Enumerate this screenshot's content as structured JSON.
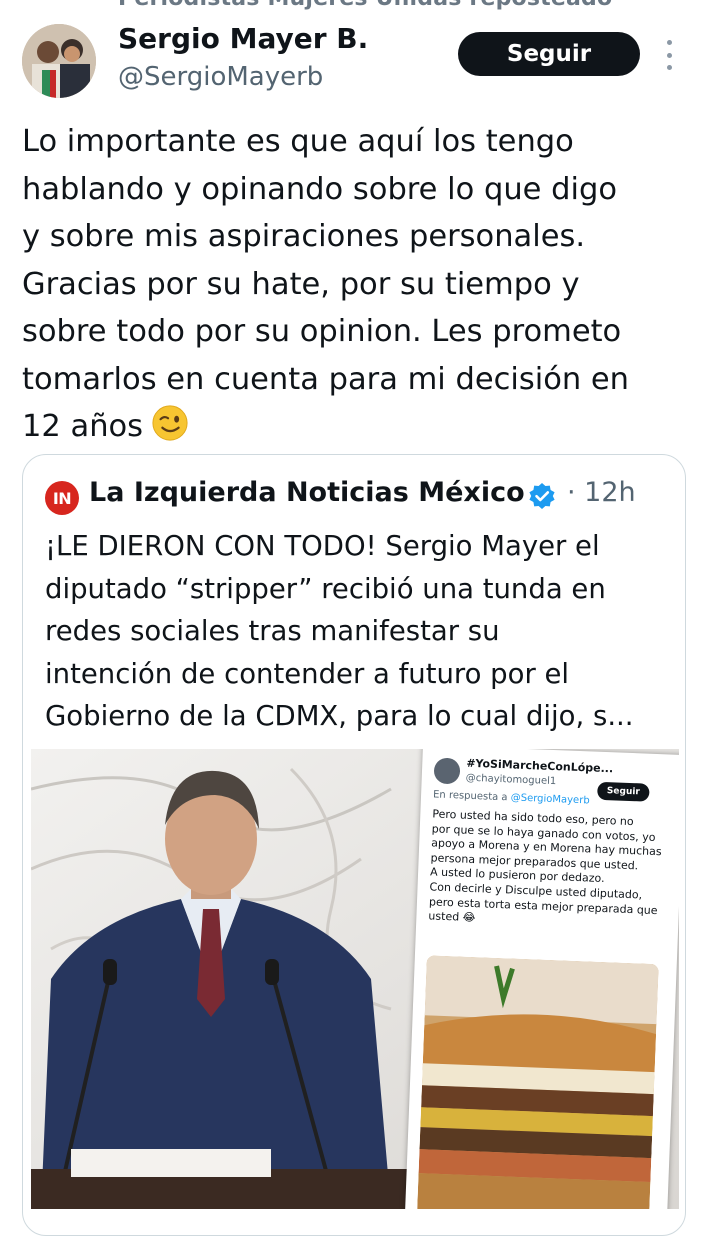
{
  "header": {
    "repost_label": "Periodistas Mujeres Unidas reposteado"
  },
  "author": {
    "name": "Sergio Mayer B.",
    "handle": "@SergioMayerb",
    "follow_label": "Seguir"
  },
  "tweet": {
    "lines": [
      "Lo importante es que aquí los tengo",
      "hablando y opinando sobre lo que digo",
      "y sobre mis aspiraciones personales.",
      "Gracias por su hate, por su tiempo y",
      "sobre todo por su opinion. Les prometo",
      "tomarlos en cuenta para mi decisión en",
      "12 años"
    ],
    "emoji": "winking-face"
  },
  "quote": {
    "logo_text": "IN",
    "name": "La Izquierda Noticias México",
    "time": "· 12h",
    "lines": [
      "¡LE DIERON CON TODO! Sergio Mayer el",
      "diputado “stripper” recibió una tunda en",
      "redes sociales tras manifestar su",
      "intención de contender a futuro por el",
      "Gobierno de la CDMX, para lo cual dijo, s..."
    ]
  },
  "embedded_screenshot": {
    "name": "#YoSiMarcheConLópe...",
    "handle": "@chayitomoguel1",
    "follow_label": "Seguir",
    "reply_prefix": "En respuesta a",
    "reply_to": "@SergioMayerb",
    "lines": [
      "Pero usted ha sido todo eso, pero no",
      "por que se lo haya ganado con votos, yo",
      "apoyo a Morena y en Morena hay muchas",
      "persona mejor preparados que usted.",
      "A usted lo pusieron por dedazo.",
      "Con decirle y Disculpe usted diputado,",
      "pero esta torta esta mejor preparada que",
      "usted 😂"
    ]
  },
  "colors": {
    "text": "#0f1419",
    "secondary": "#536471",
    "verified": "#1d9bf0",
    "logo": "#d7261e",
    "border": "#cfd9de"
  }
}
